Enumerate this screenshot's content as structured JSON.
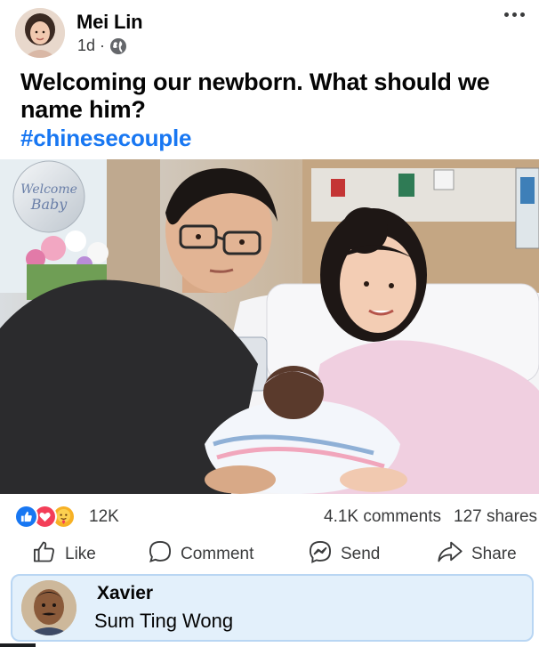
{
  "post": {
    "author": "Mei Lin",
    "time": "1d",
    "separator": "·",
    "visibility_icon": "globe-icon",
    "more_icon": "ellipsis-icon",
    "caption": "Welcoming our newborn. What should we name him?",
    "hashtag": "#chinesecouple",
    "photo_banner_text": "Welcome Baby"
  },
  "stats": {
    "reaction_icons": [
      "like-icon",
      "love-icon",
      "care-icon"
    ],
    "reaction_count": "12K",
    "comments": "4.1K comments",
    "shares": "127 shares"
  },
  "actions": {
    "like": "Like",
    "comment": "Comment",
    "send": "Send",
    "share": "Share"
  },
  "top_comment": {
    "author": "Xavier",
    "text": "Sum Ting Wong"
  },
  "colors": {
    "link": "#1877f2",
    "text": "#050505",
    "secondary": "#3a3b3c",
    "comment_bg": "#e3f0fb",
    "comment_border": "#b9d6f3",
    "like": "#1877f2",
    "love": "#f33e58"
  }
}
